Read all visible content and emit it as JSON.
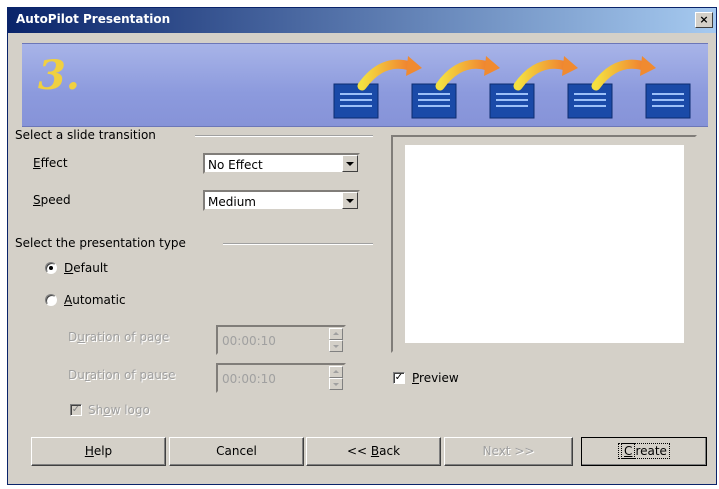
{
  "window": {
    "title": "AutoPilot Presentation",
    "close_glyph": "×"
  },
  "banner": {
    "step": "3.",
    "icon": "slide-sequence-illustration"
  },
  "transition": {
    "section_label": "Select a slide transition",
    "effect": {
      "label_first": "E",
      "label_rest": "ffect",
      "value": "No Effect"
    },
    "speed": {
      "label_first": "S",
      "label_rest": "peed",
      "value": "Medium"
    }
  },
  "presentation_type": {
    "section_label": "Select the presentation type",
    "default": {
      "label_first": "D",
      "label_rest": "efault",
      "selected": true
    },
    "automatic": {
      "label_first": "A",
      "label_rest": "utomatic",
      "selected": false
    },
    "duration_page": {
      "label_a": "D",
      "label_u": "u",
      "label_b": "ration of page",
      "value": "00:00:10"
    },
    "duration_pause": {
      "label_a": "Du",
      "label_u": "r",
      "label_b": "ation of pause",
      "value": "00:00:10"
    },
    "show_logo": {
      "label_a": "Sh",
      "label_u": "o",
      "label_b": "w logo",
      "checked": true
    }
  },
  "preview": {
    "label_first": "P",
    "label_rest": "review",
    "checked": true
  },
  "buttons": {
    "help_first": "H",
    "help_rest": "elp",
    "cancel": "Cancel",
    "back_a": "<< ",
    "back_u": "B",
    "back_b": "ack",
    "next": "Next >>",
    "create_first": "C",
    "create_rest": "reate"
  },
  "colors": {
    "title_start": "#0a246a",
    "title_end": "#a6caf0",
    "banner": "#8c9add",
    "step": "#f0d040",
    "dialog": "#d4d0c8"
  }
}
